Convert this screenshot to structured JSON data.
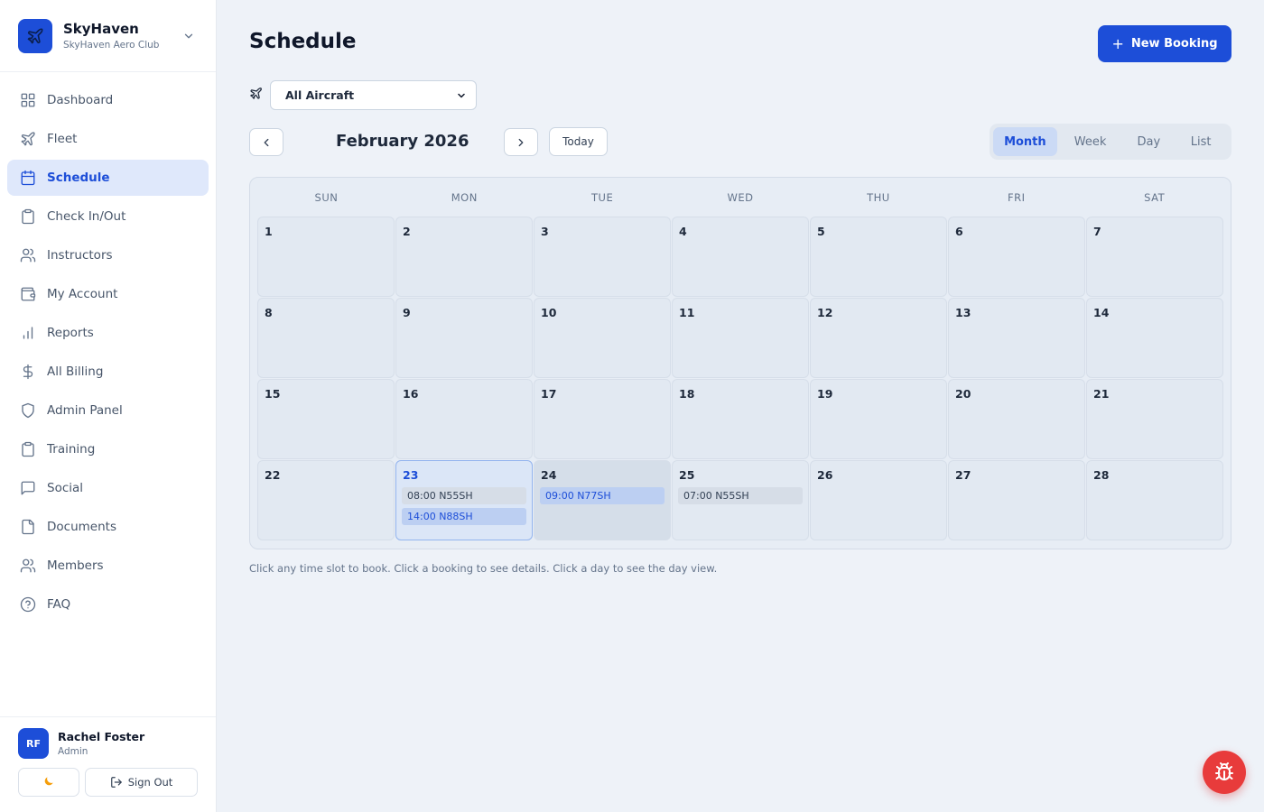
{
  "brand": {
    "name": "SkyHaven",
    "subtitle": "SkyHaven Aero Club",
    "logo_icon": "plane-icon"
  },
  "sidebar": {
    "items": [
      {
        "label": "Dashboard",
        "icon": "grid-icon",
        "active": false
      },
      {
        "label": "Fleet",
        "icon": "plane-icon",
        "active": false
      },
      {
        "label": "Schedule",
        "icon": "calendar-icon",
        "active": true
      },
      {
        "label": "Check In/Out",
        "icon": "clipboard-icon",
        "active": false
      },
      {
        "label": "Instructors",
        "icon": "users-icon",
        "active": false
      },
      {
        "label": "My Account",
        "icon": "wallet-icon",
        "active": false
      },
      {
        "label": "Reports",
        "icon": "bar-chart-icon",
        "active": false
      },
      {
        "label": "All Billing",
        "icon": "dollar-icon",
        "active": false
      },
      {
        "label": "Admin Panel",
        "icon": "shield-icon",
        "active": false
      },
      {
        "label": "Training",
        "icon": "clipboard-icon",
        "active": false
      },
      {
        "label": "Social",
        "icon": "chat-icon",
        "active": false
      },
      {
        "label": "Documents",
        "icon": "file-icon",
        "active": false
      },
      {
        "label": "Members",
        "icon": "users-icon",
        "active": false
      },
      {
        "label": "FAQ",
        "icon": "help-circle-icon",
        "active": false
      }
    ]
  },
  "user": {
    "initials": "RF",
    "name": "Rachel Foster",
    "role": "Admin",
    "sign_out_label": "Sign Out",
    "theme_icon": "moon-icon"
  },
  "header": {
    "title": "Schedule",
    "new_booking_label": "New Booking"
  },
  "filter": {
    "aircraft_selected": "All Aircraft"
  },
  "calendar_nav": {
    "month_label": "February 2026",
    "today_label": "Today"
  },
  "views": [
    {
      "label": "Month",
      "active": true
    },
    {
      "label": "Week",
      "active": false
    },
    {
      "label": "Day",
      "active": false
    },
    {
      "label": "List",
      "active": false
    }
  ],
  "calendar": {
    "weekdays": [
      "SUN",
      "MON",
      "TUE",
      "WED",
      "THU",
      "FRI",
      "SAT"
    ],
    "weeks": [
      [
        {
          "day": "1"
        },
        {
          "day": "2"
        },
        {
          "day": "3"
        },
        {
          "day": "4"
        },
        {
          "day": "5"
        },
        {
          "day": "6"
        },
        {
          "day": "7"
        }
      ],
      [
        {
          "day": "8"
        },
        {
          "day": "9"
        },
        {
          "day": "10"
        },
        {
          "day": "11"
        },
        {
          "day": "12"
        },
        {
          "day": "13"
        },
        {
          "day": "14"
        }
      ],
      [
        {
          "day": "15"
        },
        {
          "day": "16"
        },
        {
          "day": "17"
        },
        {
          "day": "18"
        },
        {
          "day": "19"
        },
        {
          "day": "20"
        },
        {
          "day": "21"
        }
      ],
      [
        {
          "day": "22"
        },
        {
          "day": "23",
          "today": true,
          "events": [
            {
              "label": "08:00 N55SH",
              "style": "grey"
            },
            {
              "label": "14:00 N88SH",
              "style": "blue"
            }
          ]
        },
        {
          "day": "24",
          "selected": true,
          "events": [
            {
              "label": "09:00 N77SH",
              "style": "blue"
            }
          ]
        },
        {
          "day": "25",
          "events": [
            {
              "label": "07:00 N55SH",
              "style": "grey"
            }
          ]
        },
        {
          "day": "26"
        },
        {
          "day": "27"
        },
        {
          "day": "28"
        }
      ]
    ]
  },
  "hint": "Click any time slot to book. Click a booking to see details. Click a day to see the day view.",
  "colors": {
    "primary": "#1d4ed8",
    "bug_button": "#e83b3b",
    "background": "#eef2f8"
  }
}
